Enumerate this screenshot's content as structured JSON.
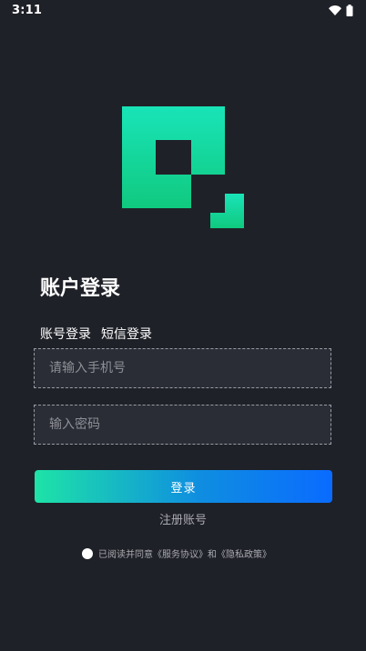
{
  "status_bar": {
    "time": "3:11",
    "icons": [
      "wifi-icon",
      "battery-icon"
    ]
  },
  "logo": {
    "icon": "brand-logo",
    "colors": {
      "top": "#19e4b8",
      "bottom": "#10c97f"
    }
  },
  "page": {
    "title": "账户登录"
  },
  "tabs": [
    {
      "label": "账号登录"
    },
    {
      "label": "短信登录"
    }
  ],
  "form": {
    "phone": {
      "value": "",
      "placeholder": "请输入手机号"
    },
    "password": {
      "value": "",
      "placeholder": "输入密码"
    },
    "login_label": "登录",
    "register_label": "注册账号"
  },
  "agreement": {
    "prefix": "已阅读并同意",
    "service": "《服务协议》",
    "and": "和",
    "privacy": "《隐私政策》",
    "checked": false
  },
  "colors": {
    "background": "#1f2128",
    "input_background": "#2b2d36",
    "accent_start": "#1ee3a7",
    "accent_end": "#0a6bff"
  }
}
